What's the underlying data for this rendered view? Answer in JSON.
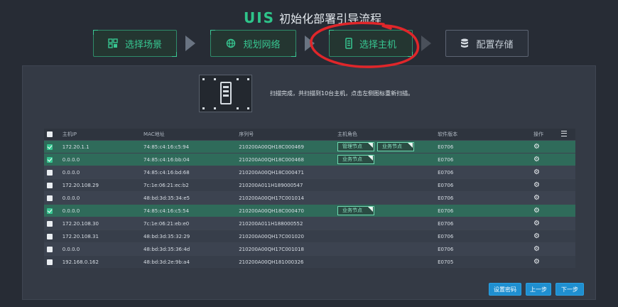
{
  "header": {
    "brand": "UIS",
    "title": "初始化部署引导流程"
  },
  "steps": [
    {
      "label": "选择场景",
      "icon": "scene-icon",
      "status": "done"
    },
    {
      "label": "规划网络",
      "icon": "globe-icon",
      "status": "done"
    },
    {
      "label": "选择主机",
      "icon": "host-icon",
      "status": "active"
    },
    {
      "label": "配置存储",
      "icon": "database-icon",
      "status": "todo"
    }
  ],
  "scan": {
    "message": "扫描完成，共扫描到10台主机，点击左侧图标重新扫描。"
  },
  "table": {
    "columns": [
      "主机IP",
      "MAC地址",
      "序列号",
      "主机角色",
      "软件版本",
      "操作"
    ],
    "rows": [
      {
        "checked": true,
        "ip": "172.20.1.1",
        "mac": "74:85:c4:16:c5:94",
        "serial": "210200A00QH18C000469",
        "roles": [
          "管理节点",
          "业务节点"
        ],
        "version": "E0706"
      },
      {
        "checked": true,
        "ip": "0.0.0.0",
        "mac": "74:85:c4:16:bb:04",
        "serial": "210200A00QH18C000468",
        "roles": [
          "业务节点"
        ],
        "version": "E0706"
      },
      {
        "checked": false,
        "ip": "0.0.0.0",
        "mac": "74:85:c4:16:bd:68",
        "serial": "210200A00QH18C000471",
        "roles": [],
        "version": "E0706"
      },
      {
        "checked": false,
        "ip": "172.20.108.29",
        "mac": "7c:1e:06:21:ec:b2",
        "serial": "210200A011H189000547",
        "roles": [],
        "version": "E0706"
      },
      {
        "checked": false,
        "ip": "0.0.0.0",
        "mac": "48:bd:3d:35:34:e5",
        "serial": "210200A00QH17C001014",
        "roles": [],
        "version": "E0706"
      },
      {
        "checked": true,
        "ip": "0.0.0.0",
        "mac": "74:85:c4:16:c5:54",
        "serial": "210200A00QH18C000470",
        "roles": [
          "业务节点"
        ],
        "version": "E0706"
      },
      {
        "checked": false,
        "ip": "172.20.108.30",
        "mac": "7c:1e:06:21:eb:e0",
        "serial": "210200A011H188000552",
        "roles": [],
        "version": "E0706"
      },
      {
        "checked": false,
        "ip": "172.20.108.31",
        "mac": "48:bd:3d:35:32:29",
        "serial": "210200A00QH17C001020",
        "roles": [],
        "version": "E0706"
      },
      {
        "checked": false,
        "ip": "0.0.0.0",
        "mac": "48:bd:3d:35:36:4d",
        "serial": "210200A00QH17C001018",
        "roles": [],
        "version": "E0706"
      },
      {
        "checked": false,
        "ip": "192.168.0.162",
        "mac": "48:bd:3d:2e:9b:a4",
        "serial": "210200A00QH181000326",
        "roles": [],
        "version": "E0705"
      }
    ]
  },
  "buttons": {
    "set_password": "设置密码",
    "prev": "上一步",
    "next": "下一步"
  },
  "colors": {
    "accent": "#37c691",
    "primary_button": "#1f8fd0",
    "selected_row": "#2f6b5a",
    "annotation": "#e0262a"
  }
}
